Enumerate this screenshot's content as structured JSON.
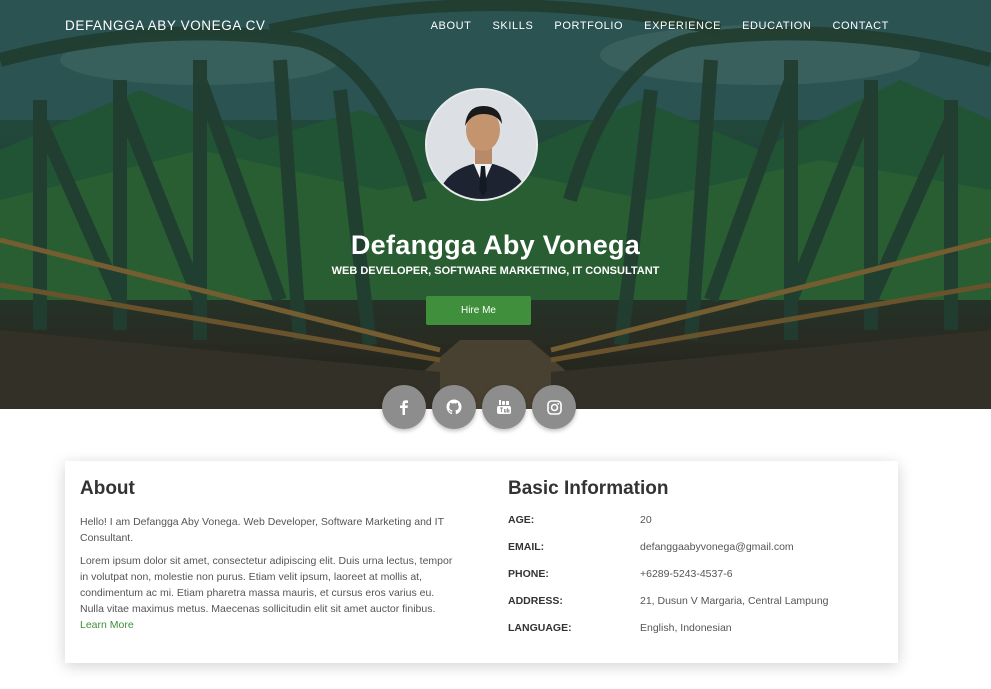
{
  "nav": {
    "brand": "DEFANGGA ABY VONEGA CV",
    "items": [
      "ABOUT",
      "SKILLS",
      "PORTFOLIO",
      "EXPERIENCE",
      "EDUCATION",
      "CONTACT"
    ]
  },
  "hero": {
    "name": "Defangga Aby Vonega",
    "subtitle": "WEB DEVELOPER, SOFTWARE MARKETING, IT CONSULTANT",
    "hire_label": "Hire Me"
  },
  "socials": [
    {
      "icon": "facebook-icon",
      "glyph": "f"
    },
    {
      "icon": "github-icon",
      "glyph": "gh"
    },
    {
      "icon": "youtube-icon",
      "glyph": "yt"
    },
    {
      "icon": "instagram-icon",
      "glyph": "ig"
    }
  ],
  "about": {
    "title": "About",
    "intro": "Hello! I am Defangga Aby Vonega. Web Developer, Software Marketing and IT Consultant.",
    "body": "Lorem ipsum dolor sit amet, consectetur adipiscing elit. Duis urna lectus, tempor in volutpat non, molestie non purus. Etiam velit ipsum, laoreet at mollis at, condimentum ac mi. Etiam pharetra massa mauris, et cursus eros varius eu. Nulla vitae maximus metus. Maecenas sollicitudin elit sit amet auctor finibus.",
    "learn_more": "Learn More"
  },
  "basic": {
    "title": "Basic Information",
    "rows": [
      {
        "key": "AGE:",
        "value": "20"
      },
      {
        "key": "EMAIL:",
        "value": "defanggaabyvonega@gmail.com"
      },
      {
        "key": "PHONE:",
        "value": "+6289-5243-4537-6"
      },
      {
        "key": "ADDRESS:",
        "value": "21, Dusun V Margaria, Central Lampung"
      },
      {
        "key": "LANGUAGE:",
        "value": "English, Indonesian"
      }
    ]
  },
  "colors": {
    "accent": "#3f8f3c",
    "social_bg": "#8d8d8d"
  }
}
